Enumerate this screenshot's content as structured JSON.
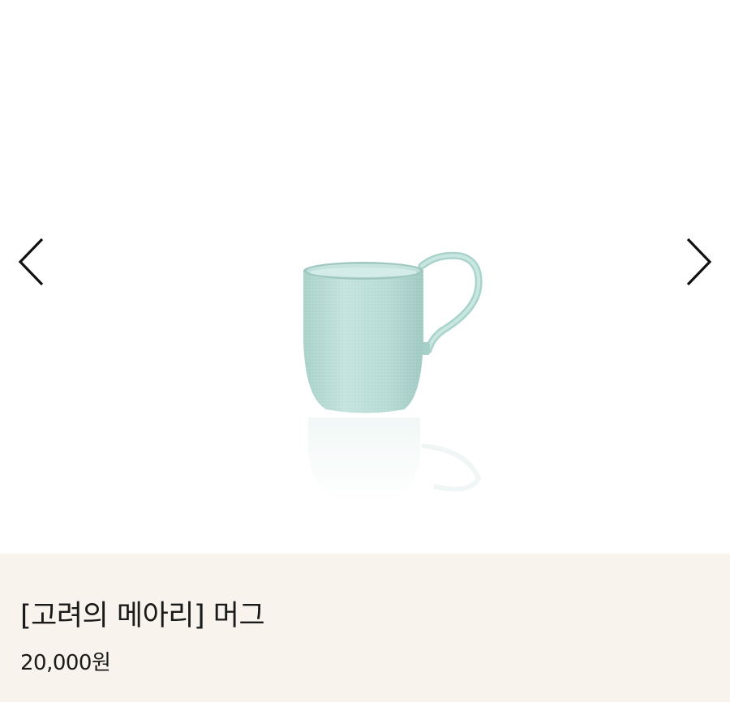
{
  "gallery": {
    "prev_arrow_icon": "chevron-left-icon",
    "next_arrow_icon": "chevron-right-icon",
    "product_image_icon": "celadon-mug-image",
    "mug_color": "#b9dcd6"
  },
  "product": {
    "title": "[고려의 메아리] 머그",
    "price": "20,000원"
  }
}
